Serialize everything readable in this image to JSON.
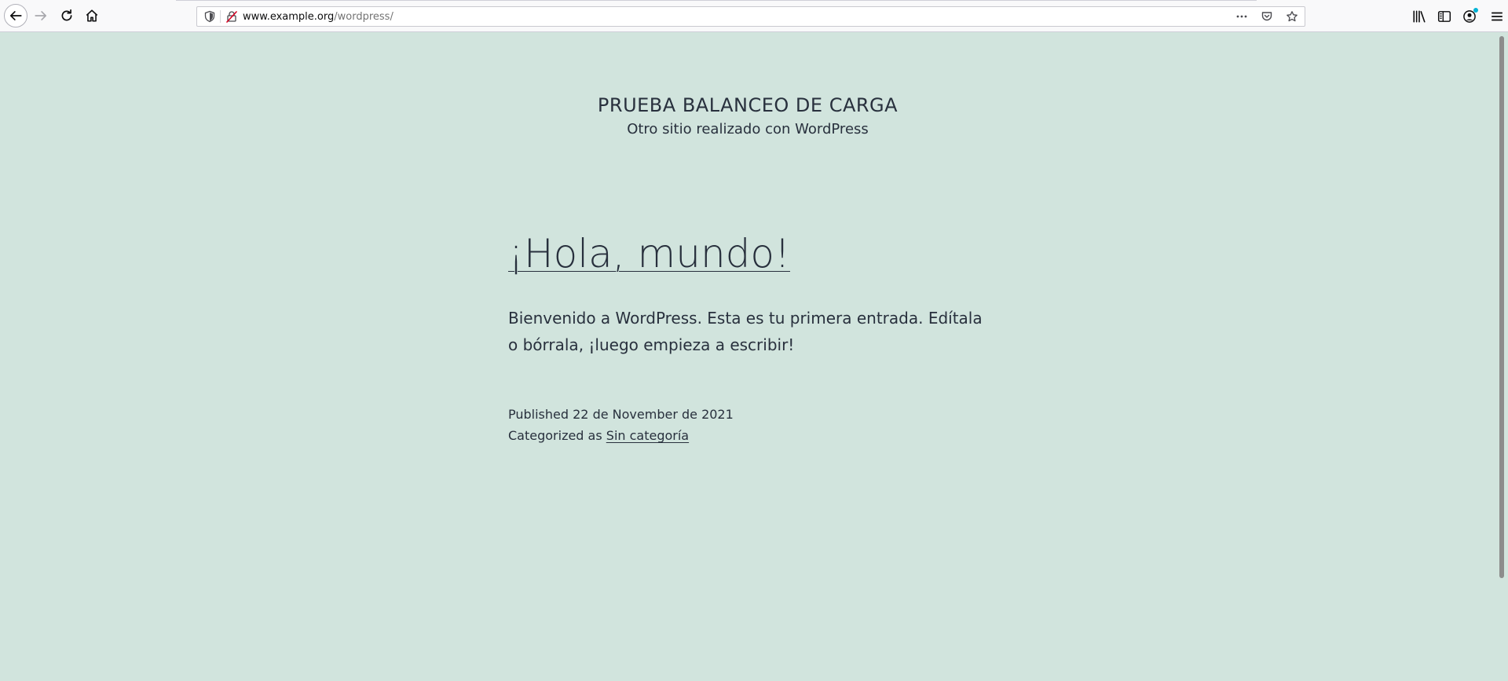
{
  "browser": {
    "url_domain": "www.example.org",
    "url_path": "/wordpress/",
    "icons": {
      "back": "arrow-left-icon",
      "forward": "arrow-right-icon",
      "reload": "reload-icon",
      "home": "home-icon",
      "tracking": "shield-icon",
      "insecure": "broken-lock-icon",
      "page_actions": "more-icon",
      "pocket": "pocket-icon",
      "bookmark": "star-icon",
      "library": "library-icon",
      "sidebar": "sidebar-icon",
      "account": "account-icon",
      "menu": "hamburger-icon"
    }
  },
  "site": {
    "title": "PRUEBA BALANCEO DE CARGA",
    "description": "Otro sitio realizado con WordPress"
  },
  "post": {
    "title": "¡Hola, mundo!",
    "content": "Bienvenido a WordPress. Esta es tu primera entrada. Edítala o bórrala, ¡luego empieza a escribir!",
    "published_label": "Published",
    "published_date": "22 de November de 2021",
    "category_label": "Categorized as",
    "category": "Sin categoría"
  },
  "colors": {
    "background": "#d1e4dd",
    "text": "#28303d"
  }
}
